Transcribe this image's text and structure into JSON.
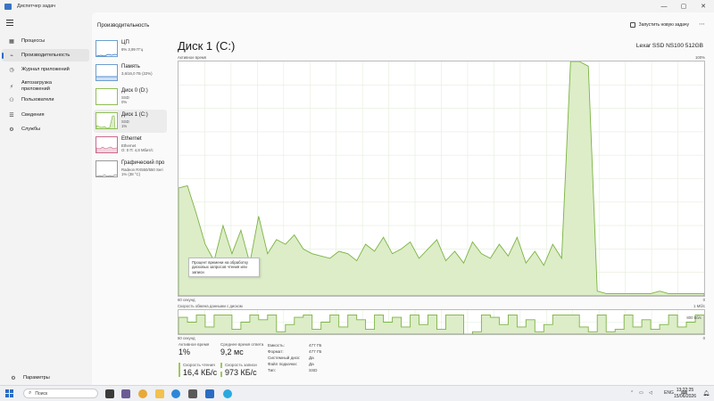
{
  "window": {
    "title": "Диспетчер задач",
    "minimize": "—",
    "maximize": "▢",
    "close": "✕"
  },
  "nav": {
    "items": [
      {
        "label": "Процессы",
        "icon": "grid-icon"
      },
      {
        "label": "Производительность",
        "icon": "performance-icon",
        "active": true
      },
      {
        "label": "Журнал приложений",
        "icon": "history-icon"
      },
      {
        "label": "Автозагрузка приложений",
        "icon": "startup-icon"
      },
      {
        "label": "Пользователи",
        "icon": "users-icon"
      },
      {
        "label": "Сведения",
        "icon": "details-icon"
      },
      {
        "label": "Службы",
        "icon": "services-icon"
      }
    ],
    "settings": "Параметры"
  },
  "header": {
    "title": "Производительность",
    "run_task": "Запустить новую задачу",
    "more": "⋯"
  },
  "devices": [
    {
      "name": "ЦП",
      "line2": "8% 3,99 ГГц",
      "line3": ""
    },
    {
      "name": "Память",
      "line2": "3,6/16,0 ГБ (22%)",
      "line3": ""
    },
    {
      "name": "Диск 0 (D:)",
      "line2": "SSD",
      "line3": "0%"
    },
    {
      "name": "Диск 1 (C:)",
      "line2": "SSD",
      "line3": "1%",
      "active": true
    },
    {
      "name": "Ethernet",
      "line2": "Ethernet",
      "line3": "О: 0 П: 4,8 Мбит/с"
    },
    {
      "name": "Графический про",
      "line2": "Radeon RX550/550 Seri",
      "line3": "1% (38 °C)"
    }
  ],
  "detail": {
    "title": "Диск 1 (C:)",
    "model": "Lexar SSD NS100 512GB",
    "graph1": {
      "label": "Активное время",
      "max": "100%",
      "time": "60 секунд",
      "min": "0"
    },
    "graph2": {
      "label": "Скорость обмена данными с диском",
      "max": "1 Мб/с",
      "mid": "800 Кб/с",
      "time": "60 секунд",
      "min": "0"
    },
    "tooltip": "Процент времени на обработку дисковых запросов чтения или записи"
  },
  "stats": {
    "active_time": {
      "label": "Активное время",
      "value": "1%"
    },
    "response": {
      "label": "Среднее время ответа",
      "value": "9,2 мс"
    },
    "read": {
      "label": "Скорость чтения",
      "value": "16,4 КБ/с"
    },
    "write": {
      "label": "Скорость записи",
      "value": "973 КБ/с"
    }
  },
  "properties": [
    {
      "key": "Емкость:",
      "value": "477 ГБ"
    },
    {
      "key": "Формат:",
      "value": "477 ГБ"
    },
    {
      "key": "Системный диск:",
      "value": "Да"
    },
    {
      "key": "Файл подкачки:",
      "value": "Да"
    },
    {
      "key": "Тип:",
      "value": "SSD"
    }
  ],
  "taskbar": {
    "search_placeholder": "Поиск",
    "lang": "ENG",
    "time": "13:22:25",
    "date": "15/06/2026"
  },
  "colors": {
    "accent": "#2a6cc4",
    "disk_line": "#7cb342",
    "disk_fill": "#dcedc8",
    "net_line": "#c96b8b"
  },
  "chart_data": [
    {
      "type": "area",
      "title": "Активное время",
      "ylim": [
        0,
        100
      ],
      "x_span": "60 секунд",
      "values": [
        46,
        47,
        35,
        22,
        15,
        30,
        18,
        28,
        14,
        34,
        18,
        24,
        22,
        26,
        20,
        18,
        17,
        16,
        19,
        18,
        15,
        22,
        19,
        25,
        18,
        20,
        23,
        16,
        20,
        24,
        15,
        19,
        14,
        23,
        18,
        16,
        22,
        17,
        25,
        14,
        19,
        13,
        22,
        16,
        100,
        100,
        98,
        2,
        1,
        1,
        1,
        1,
        1,
        1,
        2,
        1,
        1,
        1,
        1,
        1
      ]
    },
    {
      "type": "area",
      "title": "Скорость обмена данными с диском",
      "ylim": [
        0,
        1000
      ],
      "values": [
        700,
        500,
        800,
        300,
        800,
        800,
        200,
        500,
        800,
        600,
        800,
        100,
        400,
        700,
        800,
        200,
        500,
        800,
        300,
        800,
        600,
        200,
        800,
        500,
        700,
        300,
        800,
        400,
        800,
        200,
        800,
        800,
        0,
        100,
        800,
        700,
        400,
        800,
        300,
        600,
        100,
        400,
        800,
        800,
        800,
        300,
        100,
        800,
        100,
        200,
        800,
        300,
        600,
        200,
        400,
        800,
        300,
        500,
        800,
        700
      ]
    }
  ]
}
